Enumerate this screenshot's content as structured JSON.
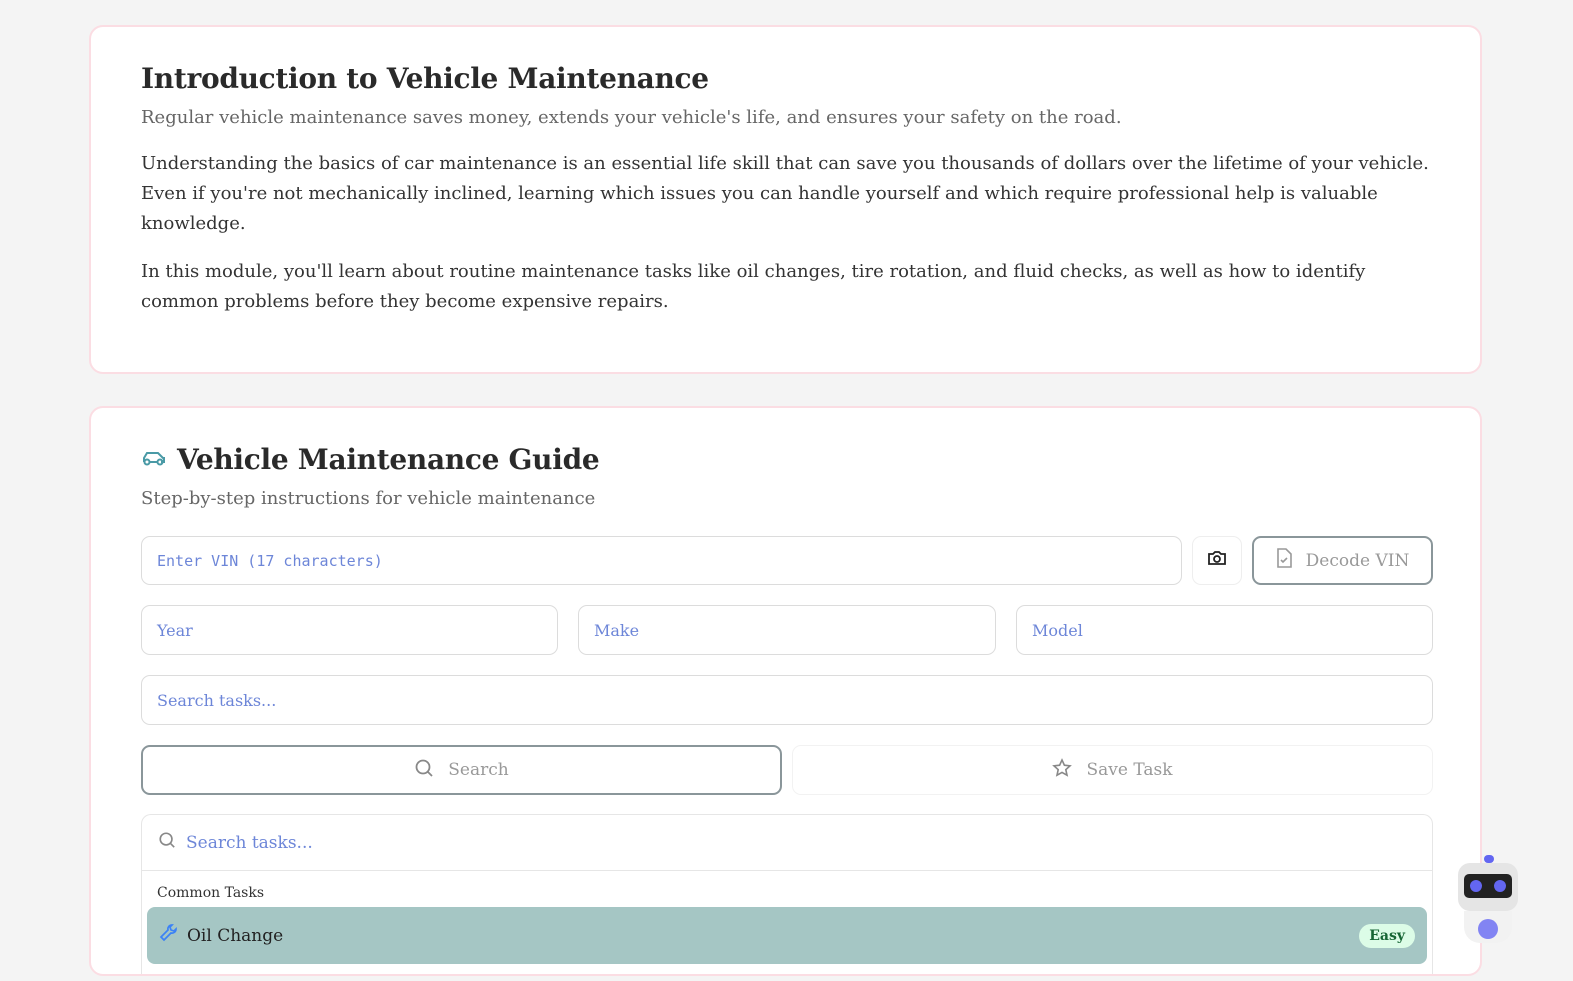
{
  "intro": {
    "title": "Introduction to Vehicle Maintenance",
    "subtitle": "Regular vehicle maintenance saves money, extends your vehicle's life, and ensures your safety on the road.",
    "paragraphs": [
      "Understanding the basics of car maintenance is an essential life skill that can save you thousands of dollars over the lifetime of your vehicle. Even if you're not mechanically inclined, learning which issues you can handle yourself and which require professional help is valuable knowledge.",
      "In this module, you'll learn about routine maintenance tasks like oil changes, tire rotation, and fluid checks, as well as how to identify common problems before they become expensive repairs."
    ]
  },
  "guide": {
    "title": "Vehicle Maintenance Guide",
    "subtitle": "Step-by-step instructions for vehicle maintenance",
    "vin_placeholder": "Enter VIN (17 characters)",
    "decode_label": "Decode VIN",
    "year_placeholder": "Year",
    "make_placeholder": "Make",
    "model_placeholder": "Model",
    "search_tasks_placeholder": "Search tasks...",
    "search_label": "Search",
    "save_label": "Save Task",
    "command": {
      "placeholder": "Search tasks...",
      "group": "Common Tasks",
      "items": [
        {
          "label": "Oil Change",
          "badge": "Easy"
        }
      ]
    }
  },
  "colors": {
    "accent": "#6366f1",
    "selected": "#a5c6c4",
    "border": "#fbdde3"
  }
}
